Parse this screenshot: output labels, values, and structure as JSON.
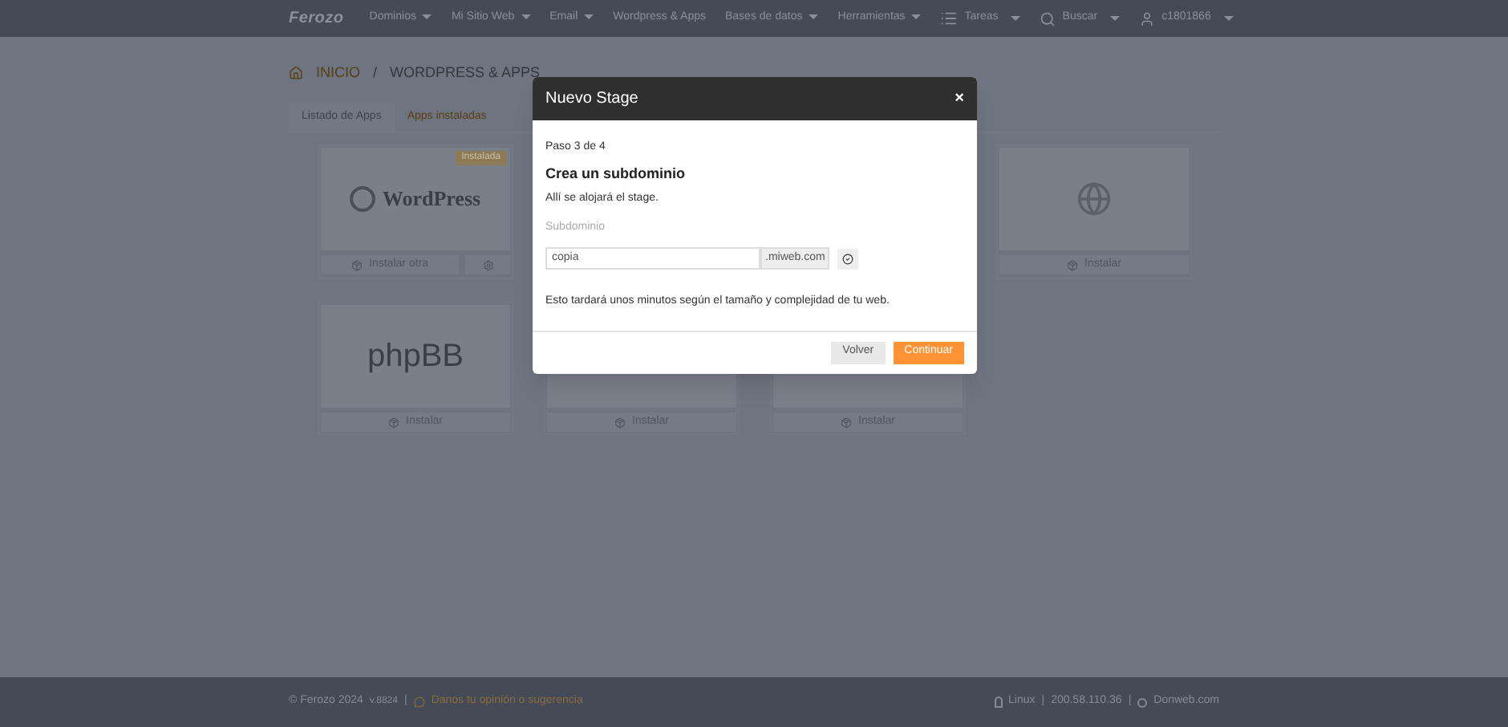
{
  "navbar": {
    "logo": "Ferozo",
    "menu": [
      {
        "label": "Dominios",
        "dropdown": true
      },
      {
        "label": "Mi Sitio Web",
        "dropdown": true
      },
      {
        "label": "Email",
        "dropdown": true
      },
      {
        "label": "Wordpress & Apps",
        "dropdown": false
      },
      {
        "label": "Bases de datos",
        "dropdown": true
      },
      {
        "label": "Herramientas",
        "dropdown": true
      }
    ],
    "right": [
      {
        "kind": "tasks",
        "label": "Tareas"
      },
      {
        "kind": "search",
        "label": "Buscar"
      },
      {
        "kind": "user",
        "label": "c1801866"
      }
    ]
  },
  "breadcrumb": {
    "items": [
      "INICIO",
      "WORDPRESS & APPS"
    ],
    "separator": "/"
  },
  "tabs": [
    {
      "label": "Listado de Apps",
      "selected": true
    },
    {
      "label": "Apps instaladas",
      "selected": false
    }
  ],
  "cards": [
    {
      "kind": "wordpress",
      "logo_text": "WordPress",
      "badge": "Instalada",
      "action": "Instalar otra",
      "settings": true
    },
    {
      "kind": "covered"
    },
    {
      "kind": "covered"
    },
    {
      "kind": "icon",
      "action": "Instalar"
    },
    {
      "kind": "phpbb",
      "logo_text": "phpBB",
      "action": "Instalar"
    },
    {
      "kind": "hidden",
      "action": "Instalar"
    },
    {
      "kind": "hidden",
      "action": "Instalar"
    }
  ],
  "modal": {
    "title": "Nuevo Stage",
    "close": "×",
    "step": "Paso 3 de 4",
    "heading": "Crea un subdominio",
    "subtitle": "Allí se alojará el stage.",
    "field_label": "Subdominio",
    "field_value": "copia",
    "field_suffix": ".miweb.com",
    "note": "Esto tardará unos minutos según el tamaño y complejidad de tu web.",
    "buttons": [
      {
        "label": "Volver",
        "primary": false
      },
      {
        "label": "Continuar",
        "primary": true
      }
    ]
  },
  "footer": {
    "separator": "|",
    "copyright": "© Ferozo 2024",
    "version": "v.8824",
    "feedback": "Danos tu opinión o sugerencia",
    "os": "Linux",
    "ip": "200.58.110.36",
    "site": "Donweb.com"
  }
}
